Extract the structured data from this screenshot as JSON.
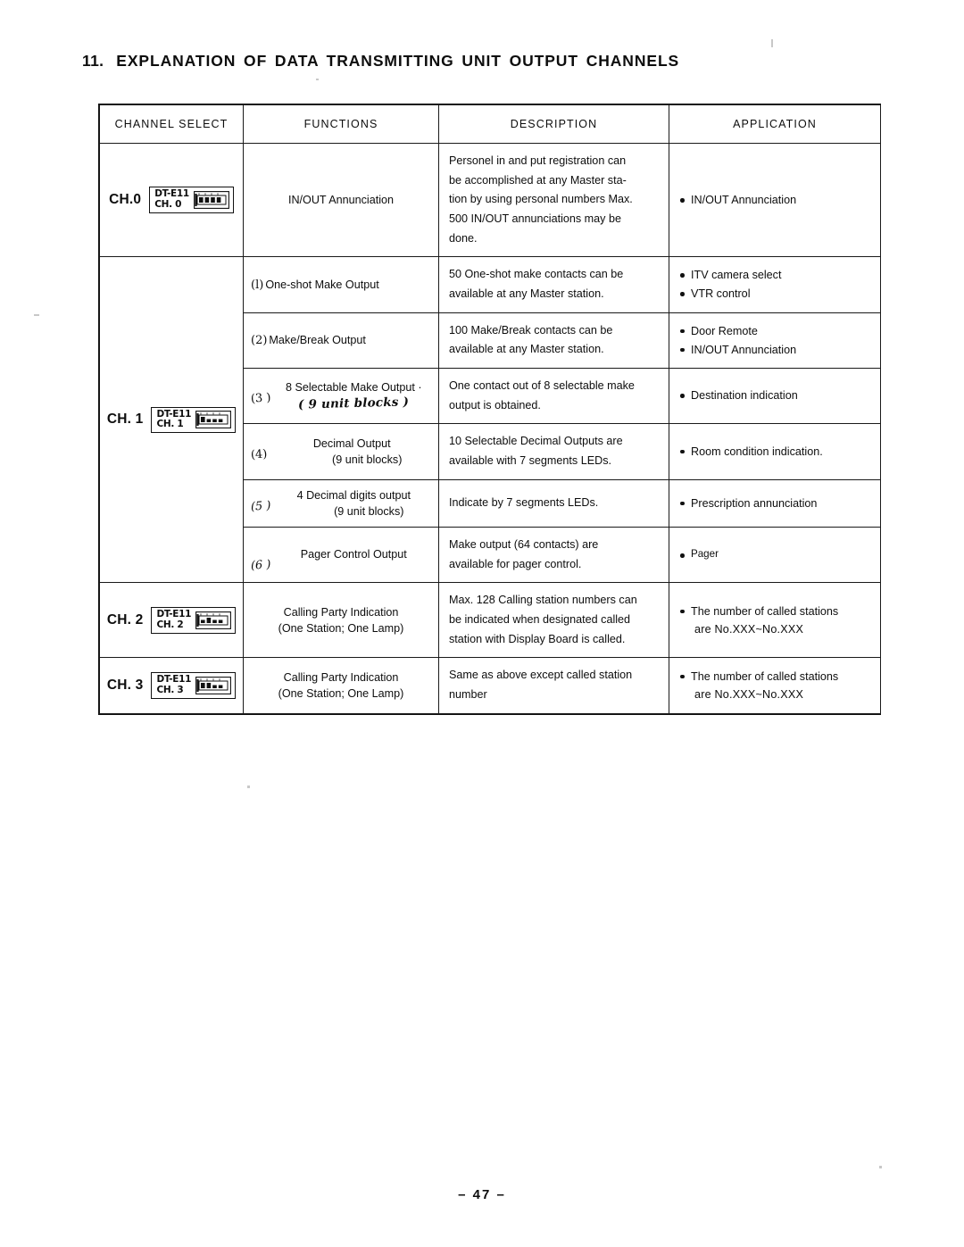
{
  "document": {
    "section_number": "11.",
    "title": "EXPLANATION OF DATA TRANSMITTING UNIT OUTPUT CHANNELS",
    "page_folio": "– 47 –"
  },
  "table": {
    "headers": [
      "CHANNEL SELECT",
      "FUNCTIONS",
      "DESCRIPTION",
      "APPLICATION"
    ],
    "channels": [
      {
        "label": "CH.0",
        "badge_model": "DT-E11",
        "badge_channel": "CH. 0"
      },
      {
        "label": "CH. 1",
        "badge_model": "DT-E11",
        "badge_channel": "CH. 1"
      },
      {
        "label": "CH. 2",
        "badge_model": "DT-E11",
        "badge_channel": "CH. 2"
      },
      {
        "label": "CH. 3",
        "badge_model": "DT-E11",
        "badge_channel": "CH. 3"
      }
    ],
    "rows": {
      "ch0": {
        "function": "IN/OUT Annunciation",
        "description": [
          "Personel in and put registration can",
          "be accomplished at any Master sta-",
          "tion by using personal numbers Max.",
          "500 IN/OUT annunciations may be",
          "done."
        ],
        "applications": [
          "IN/OUT Annunciation"
        ]
      },
      "ch1_1": {
        "index": "(l)",
        "function": "One-shot Make Output",
        "description": [
          "50   One-shot make contacts can be",
          "available at any Master station."
        ],
        "applications": [
          "ITV camera select",
          "VTR control"
        ]
      },
      "ch1_2": {
        "index": "(2)",
        "function": "Make/Break Output",
        "description": [
          "100   Make/Break contacts can be",
          "available at any Master station."
        ],
        "applications": [
          "Door Remote",
          "IN/OUT Annunciation"
        ]
      },
      "ch1_3": {
        "index": "(3 )",
        "function_line1": "8 Selectable Make Output ·",
        "function_line2_handwritten": "( 9 unit blocks )",
        "description": [
          "One contact out of 8 selectable make",
          "output is obtained."
        ],
        "applications": [
          "Destination indication"
        ]
      },
      "ch1_4": {
        "index": "(4)",
        "function_line1": "Decimal Output",
        "function_line2": "(9 unit blocks)",
        "description": [
          "10 Selectable Decimal Outputs are",
          "available with 7 segments LEDs."
        ],
        "applications": [
          "Room condition indication."
        ]
      },
      "ch1_5": {
        "index": "(5 )",
        "function_line1": "4 Decimal digits output",
        "function_line2": "(9 unit blocks)",
        "description": [
          "Indicate by 7 segments LEDs."
        ],
        "applications": [
          "Prescription annunciation"
        ]
      },
      "ch1_6": {
        "index": "(6 )",
        "function_line1": "Pager Control Output",
        "description": [
          "Make output (64 contacts) are",
          "available for pager control."
        ],
        "applications": [
          "Pager"
        ]
      },
      "ch2": {
        "function_line1": "Calling Party Indication",
        "function_line2": "(One Station; One Lamp)",
        "description": [
          "Max. 128 Calling station numbers can",
          "be indicated when designated called",
          "station with Display Board is called."
        ],
        "application_line1": "The number of called stations",
        "application_line2": "are No.XXX~No.XXX"
      },
      "ch3": {
        "function_line1": "Calling Party Indication",
        "function_line2": "(One Station; One Lamp)",
        "description": [
          "Same as above except called station",
          "number"
        ],
        "application_line1": "The number of called stations",
        "application_line2": "are No.XXX~No.XXX"
      }
    }
  }
}
